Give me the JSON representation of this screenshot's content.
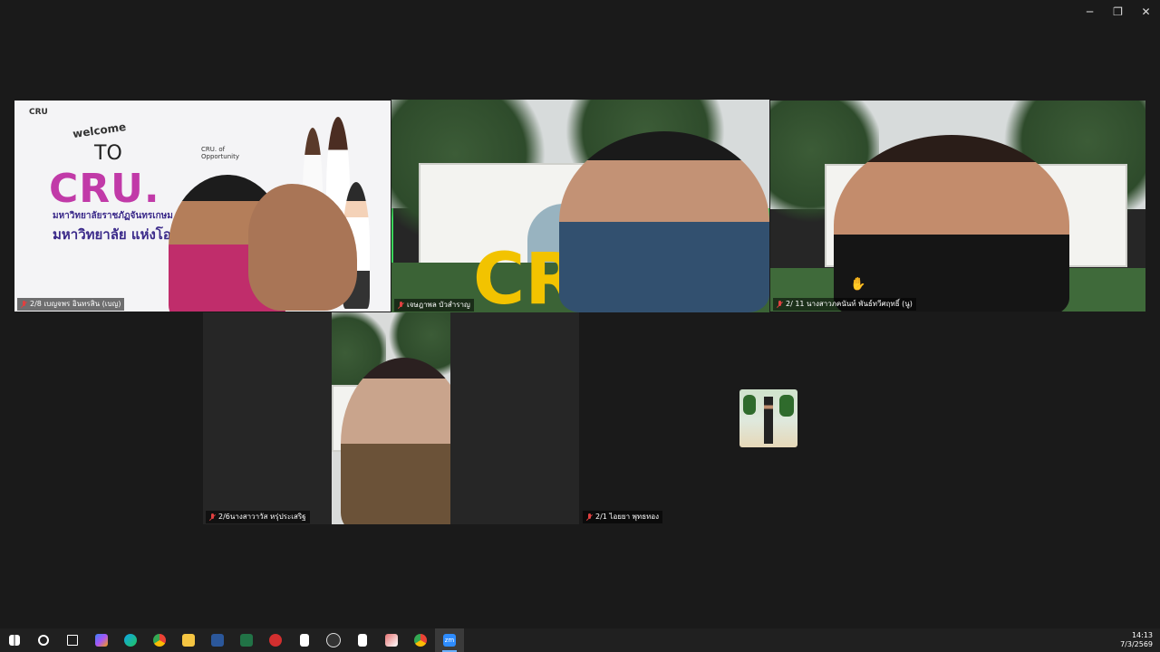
{
  "window_controls": {
    "minimize": "─",
    "restore": "❐",
    "close": "✕"
  },
  "participants": [
    {
      "name": "2/8 เบญจพร อินทรสิน (เบญ)",
      "muted": true,
      "active": false
    },
    {
      "name": "เจษฎาพล บัวสำราญ",
      "muted": true,
      "active": true
    },
    {
      "name": "2/ 11 นางสาวภคนันท์ พันธ์ทวีศฤทธิ์ (นู)",
      "muted": true,
      "active": false
    },
    {
      "name": "2/6นางสาวาวัส หรุ่ประเสริฐ",
      "muted": true,
      "active": false
    },
    {
      "name": "2/1 ไอยยา พุทธทอง",
      "muted": true,
      "active": false
    }
  ],
  "slide": {
    "brand": "CRU",
    "welcome": "welcome",
    "to": "TO",
    "cru": "CRU.",
    "tagline": "CRU. of Opportunity",
    "university_line1": "มหาวิทยาลัยราชภัฏจันทรเกษม",
    "university_line2": "มหาวิทยาลัย แห่งโอกาส"
  },
  "background_sign": "CR",
  "taskbar": {
    "icons": [
      "windows-start-icon",
      "search-icon",
      "task-view-icon",
      "copilot-icon",
      "edge-icon",
      "chrome-icon",
      "file-explorer-icon",
      "word-icon",
      "excel-icon",
      "acrobat-icon",
      "document-icon",
      "obs-icon",
      "document-icon",
      "app-icon",
      "chrome-icon",
      "zoom-icon"
    ],
    "active_index": 15,
    "time": "14:13",
    "date": "7/3/2569"
  },
  "colors": {
    "active_speaker": "#3ad35a",
    "muted_mic": "#e04040",
    "background": "#1a1a1a"
  }
}
